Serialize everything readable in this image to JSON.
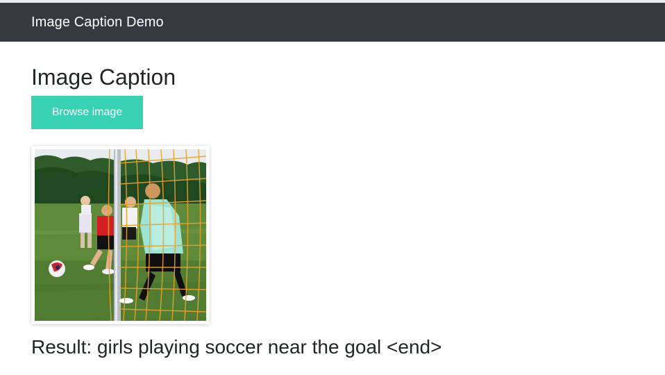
{
  "navbar": {
    "brand": "Image Caption Demo",
    "background": "#343a40"
  },
  "page": {
    "title": "Image Caption"
  },
  "upload": {
    "button_label": "Browse image",
    "button_color": "#39d1b4"
  },
  "preview": {
    "alt": "girls playing soccer near the goal"
  },
  "result": {
    "text": "Result: girls playing soccer near the goal <end>"
  }
}
